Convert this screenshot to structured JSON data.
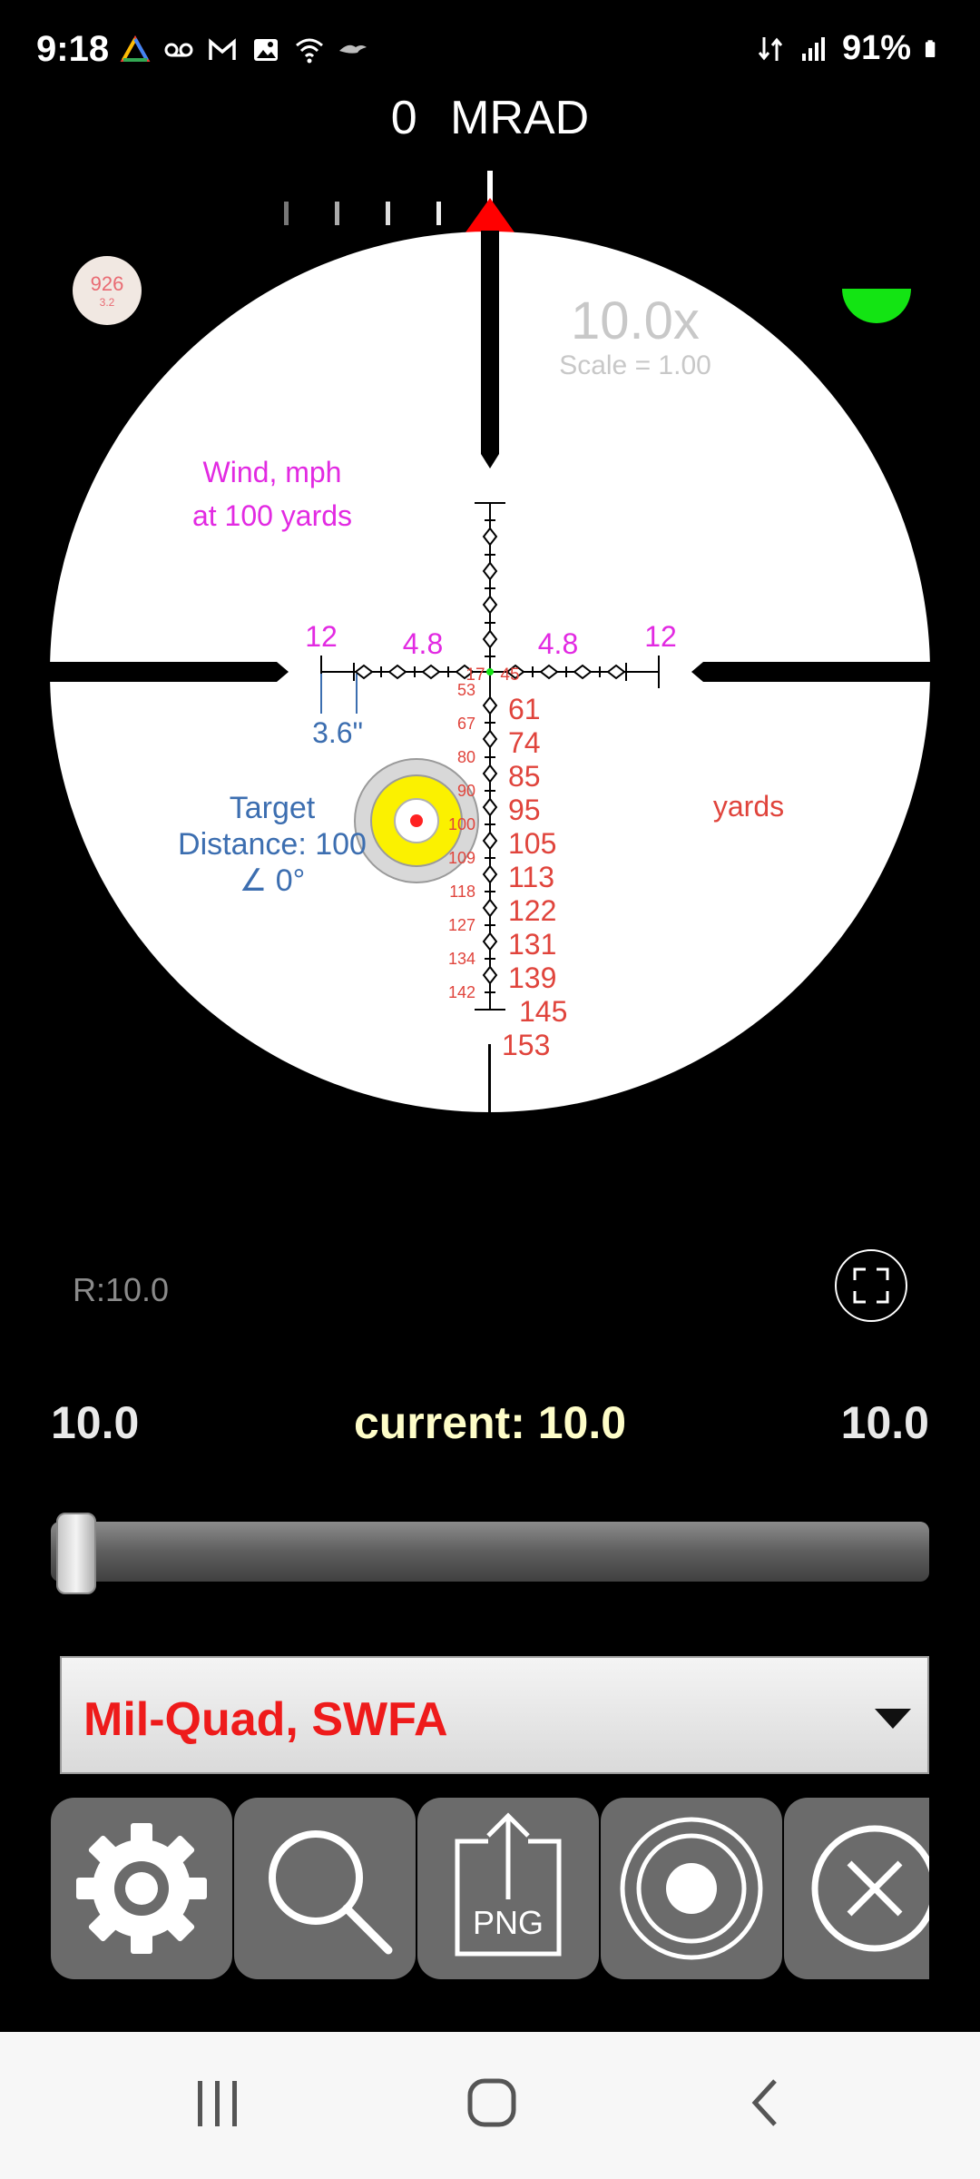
{
  "status_bar": {
    "time": "9:18",
    "battery": "91%",
    "left_icons": [
      "home-icon",
      "voicemail-icon",
      "gmail-icon",
      "gallery-icon",
      "wifi-icon",
      "ravens-icon"
    ],
    "right_icons": [
      "data-transfer-icon",
      "signal-icon",
      "battery-icon"
    ]
  },
  "heading": {
    "value": "0",
    "unit": "MRAD"
  },
  "scope": {
    "badge_big": "926",
    "badge_small": "3.2",
    "zoom": "10.0x",
    "scale": "Scale = 1.00",
    "wind_label_line1": "Wind, mph",
    "wind_label_line2": "at 100 yards",
    "wind_values": {
      "left_outer": "12",
      "left_inner": "4.8",
      "right_inner": "4.8",
      "right_outer": "12"
    },
    "spread": "3.6\"",
    "target_line1": "Target",
    "target_line2": "Distance: 100",
    "target_line3": "∠ 0°",
    "yards_label": "yards",
    "center_numbers": {
      "left": "17",
      "right": "45"
    },
    "left_ranges": [
      "53",
      "67",
      "80",
      "90",
      "100",
      "109",
      "118",
      "127",
      "134",
      "142"
    ],
    "right_ranges": [
      "61",
      "74",
      "85",
      "95",
      "105",
      "113",
      "122",
      "131",
      "139",
      "145",
      "153"
    ],
    "colors": {
      "wind": "#e22ae2",
      "range": "#e0443c",
      "target": "#3c6eb0",
      "indicator": "#13e413",
      "marker": "#ff0000"
    }
  },
  "controls": {
    "range_text": "R:10.0",
    "mag_min": "10.0",
    "mag_current": "current: 10.0",
    "mag_max": "10.0",
    "slider_position": 0.0,
    "reticle_select": "Mil-Quad, SWFA"
  },
  "toolbar": {
    "buttons": [
      "gear-icon",
      "search-icon",
      "png-export-icon",
      "target-icon",
      "close-icon"
    ],
    "png_label": "PNG"
  },
  "nav_bar": {
    "buttons": [
      "recents-icon",
      "home-icon",
      "back-icon"
    ]
  }
}
